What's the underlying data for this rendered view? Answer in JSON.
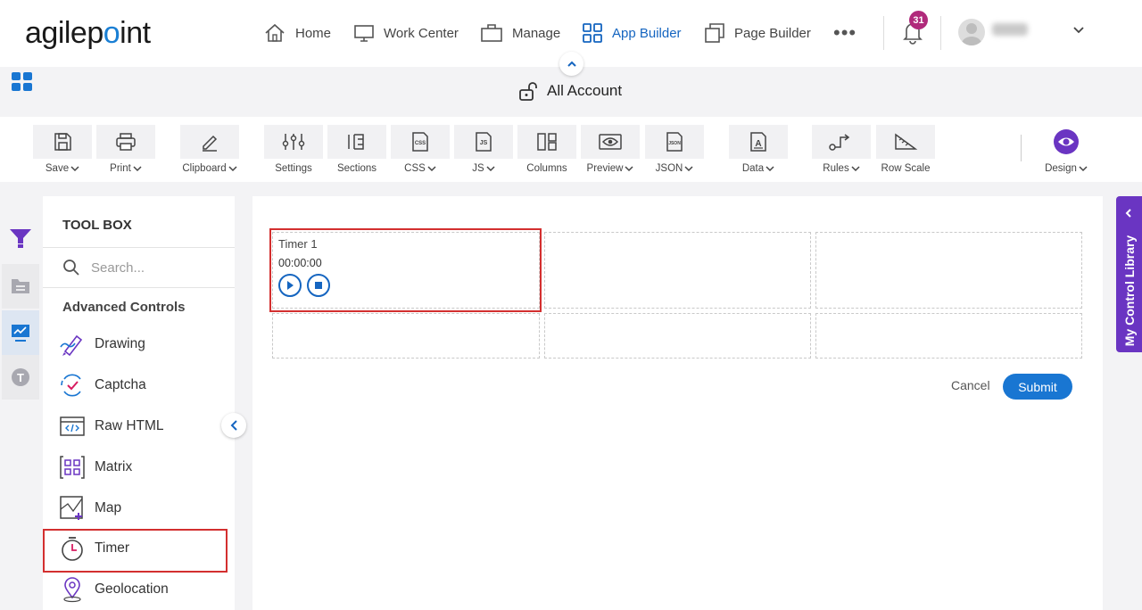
{
  "header": {
    "logo_prefix": "agilep",
    "logo_dot": "o",
    "logo_suffix": "int",
    "nav": [
      {
        "label": "Home",
        "icon": "home-icon"
      },
      {
        "label": "Work Center",
        "icon": "monitor-icon"
      },
      {
        "label": "Manage",
        "icon": "briefcase-icon"
      },
      {
        "label": "App Builder",
        "icon": "grid-icon",
        "active": true
      },
      {
        "label": "Page Builder",
        "icon": "pages-icon"
      }
    ],
    "more": "•••",
    "notification_count": "31"
  },
  "title_bar": {
    "title": "All Account"
  },
  "toolbar": {
    "save": "Save",
    "print": "Print",
    "clipboard": "Clipboard",
    "settings": "Settings",
    "sections": "Sections",
    "css": "CSS",
    "js": "JS",
    "columns": "Columns",
    "preview": "Preview",
    "json": "JSON",
    "data": "Data",
    "rules": "Rules",
    "row_scale": "Row Scale",
    "design": "Design"
  },
  "toolbox": {
    "title": "TOOL BOX",
    "search_placeholder": "Search...",
    "section": "Advanced Controls",
    "controls": [
      "Drawing",
      "Captcha",
      "Raw HTML",
      "Matrix",
      "Map",
      "Timer",
      "Geolocation"
    ]
  },
  "canvas": {
    "timer_label": "Timer 1",
    "timer_value": "00:00:00",
    "cancel": "Cancel",
    "submit": "Submit"
  },
  "control_library": {
    "label": "My Control Library"
  },
  "colors": {
    "accent": "#1976d2",
    "purple": "#6a35c2",
    "highlight": "#d32f2f",
    "badge": "#b02a7b"
  }
}
